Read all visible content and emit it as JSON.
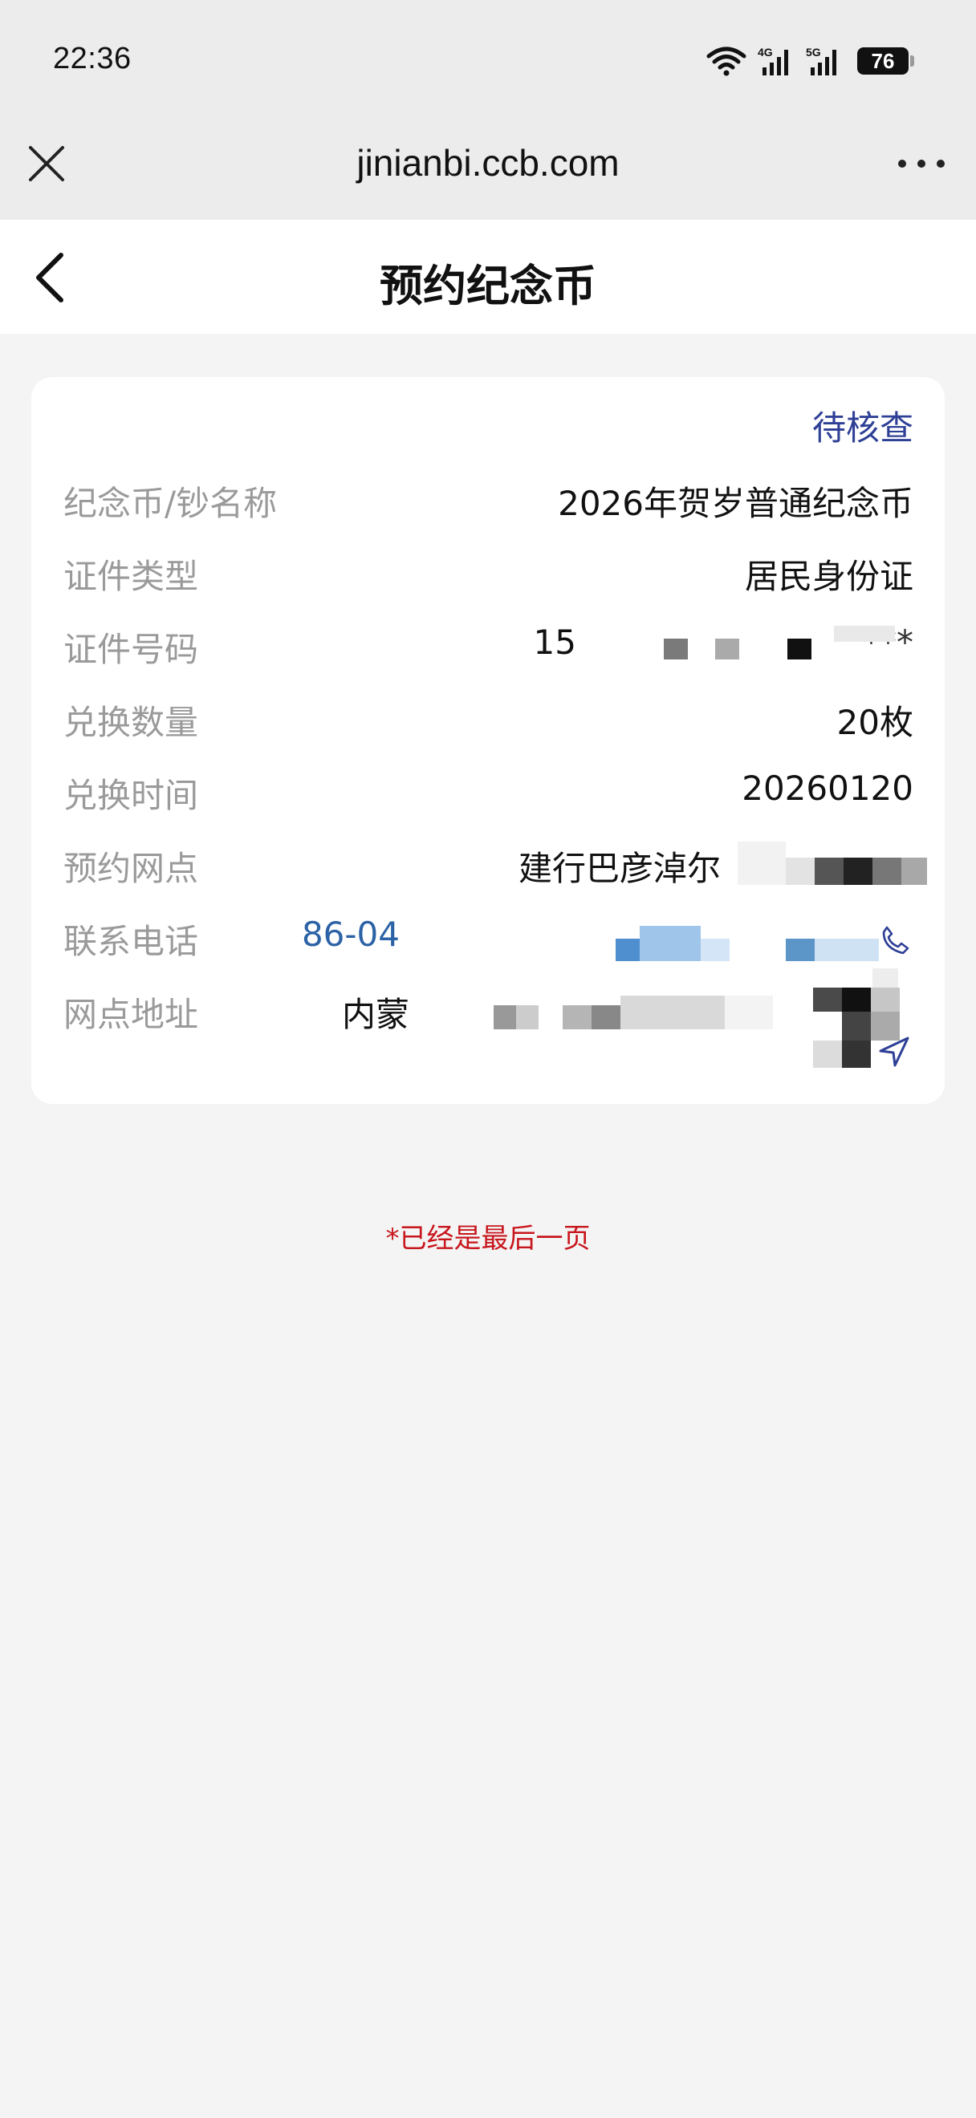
{
  "status_bar": {
    "time": "22:36",
    "network_a": "4G",
    "network_b": "5G",
    "battery": "76"
  },
  "browser": {
    "url": "jinianbi.ccb.com",
    "close_icon": "close-icon",
    "more_icon": "more-dots-icon"
  },
  "header": {
    "title": "预约纪念币",
    "back_icon": "chevron-left-icon"
  },
  "card": {
    "status": "待核查",
    "rows": [
      {
        "label": "纪念币/钞名称",
        "value": "2026年贺岁普通纪念币"
      },
      {
        "label": "证件类型",
        "value": "居民身份证"
      },
      {
        "label": "证件号码",
        "value": "15"
      },
      {
        "label": "兑换数量",
        "value": "20枚"
      },
      {
        "label": "兑换时间",
        "value": "20260120"
      },
      {
        "label": "预约网点",
        "value": "建行巴彦淖尔"
      },
      {
        "label": "联系电话",
        "value": "86-04"
      },
      {
        "label": "网点地址",
        "value": "内蒙"
      }
    ],
    "id_suffix": "***",
    "nav_icon": "navigate-arrow-icon",
    "phone_icon": "phone-icon",
    "accent_color": "#2e3f96",
    "phone_color": "#2c63a6"
  },
  "footer": {
    "end_text": "*已经是最后一页",
    "end_color": "#c8161d"
  }
}
